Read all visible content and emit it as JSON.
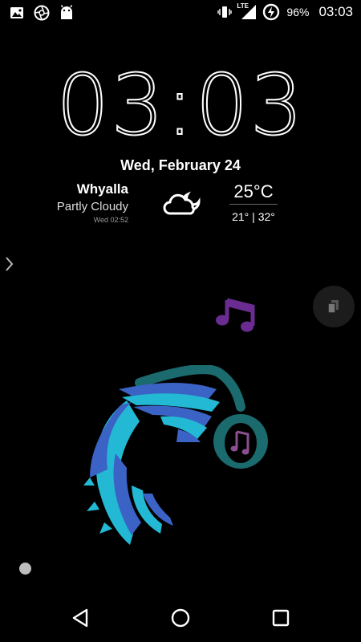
{
  "status_bar": {
    "left_icons": [
      "image-icon",
      "aperture-icon",
      "android-icon"
    ],
    "right_icons": [
      "vibrate-icon",
      "lte-signal-icon",
      "battery-charging-icon"
    ],
    "network": "LTE",
    "battery_percent": "96%",
    "time": "03:03"
  },
  "clock": {
    "time": "03:03"
  },
  "date": "Wed, February 24",
  "weather": {
    "city": "Whyalla",
    "condition": "Partly Cloudy",
    "updated": "Wed 02:52",
    "icon": "partly-cloudy-night-icon",
    "temperature": "25°C",
    "range": "21° | 32°"
  },
  "colors": {
    "note_purple": "#6a2c91",
    "headphone_teal": "#1a6a6e",
    "hair_cyan": "#23b9d4",
    "hair_blue": "#3b62c5"
  },
  "navbar": {
    "buttons": [
      "back-icon",
      "home-icon",
      "recents-icon"
    ]
  }
}
